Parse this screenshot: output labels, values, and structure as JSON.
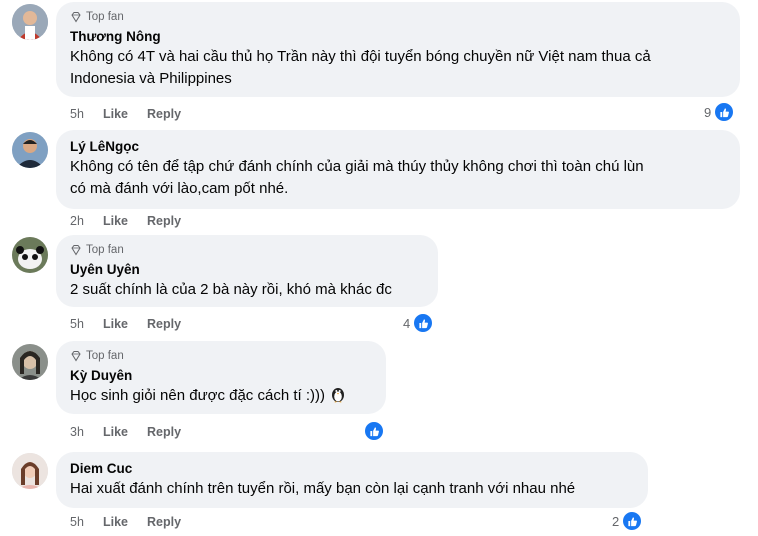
{
  "comments": [
    {
      "top_fan": "Top fan",
      "name": "Thương Nông",
      "lines": [
        "Không có 4T và hai cầu thủ họ Trần này thì đội tuyển bóng chuyền nữ Việt nam thua cả",
        "Indonesia và Philippines"
      ],
      "time": "5h",
      "like": "Like",
      "reply": "Reply",
      "reactions": "9"
    },
    {
      "top_fan": "",
      "name": "Lý LêNgọc",
      "lines": [
        "Không có tên để tập chứ đánh chính của giải mà thúy thủy không chơi thì toàn chú lùn",
        "có mà đánh với lào,cam pốt nhé."
      ],
      "time": "2h",
      "like": "Like",
      "reply": "Reply",
      "reactions": ""
    },
    {
      "top_fan": "Top fan",
      "name": "Uyên Uyên",
      "lines": [
        "2 suất chính là của 2 bà này rồi, khó mà khác đc"
      ],
      "time": "5h",
      "like": "Like",
      "reply": "Reply",
      "reactions": "4"
    },
    {
      "top_fan": "Top fan",
      "name": "Kỳ Duyên",
      "lines": [
        "Học sinh giỏi nên được đặc cách tí :)))"
      ],
      "time": "3h",
      "like": "Like",
      "reply": "Reply",
      "reactions": ""
    },
    {
      "top_fan": "",
      "name": "Diem Cuc",
      "lines": [
        "Hai xuất đánh chính trên tuyển rồi, mấy bạn còn lại cạnh tranh với nhau nhé"
      ],
      "time": "5h",
      "like": "Like",
      "reply": "Reply",
      "reactions": "2"
    }
  ],
  "colors": {
    "like_blue": "#1877f2",
    "bubble": "#f0f2f5",
    "meta": "#65676b"
  }
}
